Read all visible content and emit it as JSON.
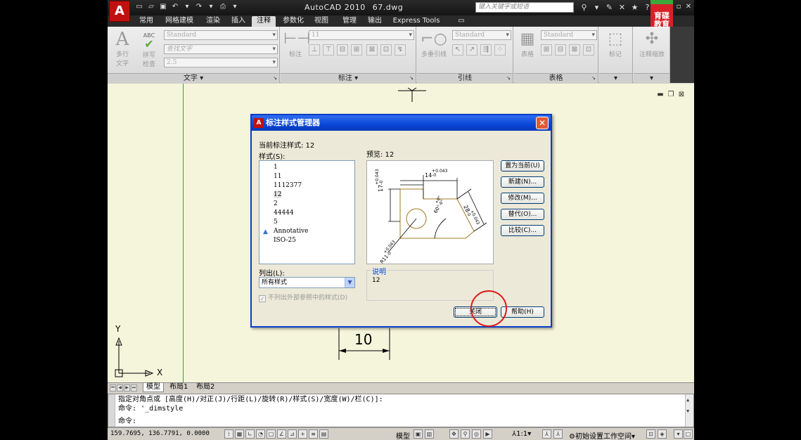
{
  "titlebar": {
    "app_logo": "A",
    "app_name": "AutoCAD 2010",
    "file_name": "67.dwg",
    "search_placeholder": "键入关键字或短语",
    "brand_text_1": "育碟",
    "brand_text_2": "教育"
  },
  "ribbon_tabs": [
    "常用",
    "网格建模",
    "渲染",
    "插入",
    "注释",
    "参数化",
    "视图",
    "管理",
    "输出",
    "Express Tools"
  ],
  "ribbon": {
    "text_panel": {
      "title": "文字",
      "multiline_text": "多行",
      "multiline_text_2": "文字",
      "spell_check": "拼写",
      "spell_check_2": "检查",
      "abc": "ABC",
      "style_combo": "Standard",
      "find_text": "查找文字",
      "height_combo": "2.5"
    },
    "dimension_panel": {
      "title": "标注",
      "dimension": "标注",
      "style_combo": "11"
    },
    "leader_panel": {
      "title": "引线",
      "multileader": "多重引线",
      "style_combo": "Standard"
    },
    "table_panel": {
      "title": "表格",
      "table": "表格",
      "style_combo": "Standard"
    },
    "markup_panel": {
      "markup": "标记"
    },
    "scale_panel": {
      "annotation_scale": "注释缩放"
    }
  },
  "drawing": {
    "dim_value": "10",
    "ucs_x": "X",
    "ucs_y": "Y"
  },
  "layout_tabs": [
    "模型",
    "布局1",
    "布局2"
  ],
  "command": {
    "line1": "指定对角点或 [高度(H)/对正(J)/行距(L)/旋转(R)/样式(S)/宽度(W)/栏(C)]:",
    "line2": "命令: '_dimstyle",
    "line3": "命令:"
  },
  "statusbar": {
    "coords": "159.7695, 136.7791, 0.0000",
    "model": "模型",
    "scale": "1:1",
    "workspace": "初始设置工作空间"
  },
  "dialog": {
    "title": "标注样式管理器",
    "current_style_label": "当前标注样式: 12",
    "styles_label": "样式(S):",
    "preview_label": "预览: 12",
    "styles": [
      "1",
      "11",
      "1112377",
      "12",
      "2",
      "44444",
      "5",
      "Annotative",
      "ISO-25"
    ],
    "selected_style": "12",
    "list_label": "列出(L):",
    "list_value": "所有样式",
    "xref_checkbox": "不列出外部参照中的样式(D)",
    "description_title": "说明",
    "description_value": "12",
    "buttons": {
      "set_current": "置为当前(U)",
      "new": "新建(N)...",
      "modify": "修改(M)...",
      "override": "替代(O)...",
      "compare": "比较(C)...",
      "close": "关闭",
      "help": "帮助(H)"
    },
    "preview_dims": {
      "top": "14",
      "top_tol_plus": "+0.043",
      "top_tol_minus": "-0",
      "left": "17",
      "left_tol_plus": "+0.043",
      "left_tol_minus": "-0",
      "right": "28",
      "right_tol_plus": "+0.043",
      "right_tol_minus": "-0",
      "angle": "60°",
      "angle_tol_plus": "+0°",
      "angle_tol_minus": "-0°",
      "radius": "R11",
      "radius_tol_plus": "+0.043",
      "radius_tol_minus": "-0"
    }
  }
}
